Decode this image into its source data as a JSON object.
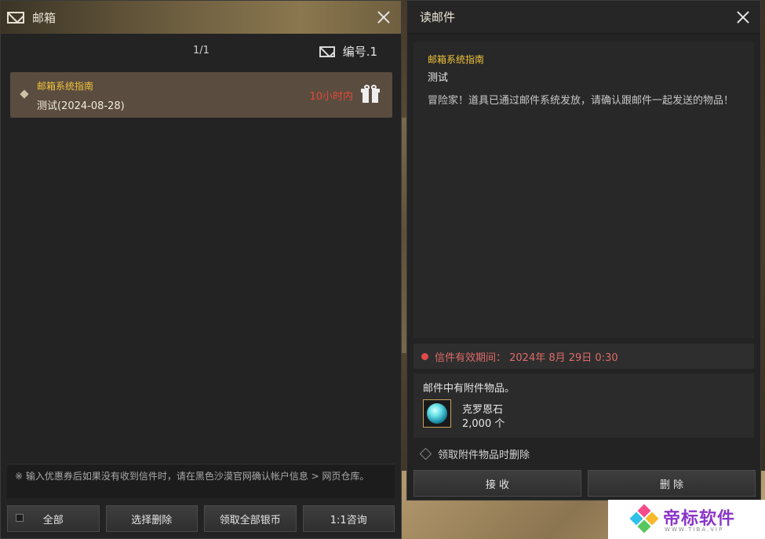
{
  "mailbox": {
    "title": "邮箱",
    "page_count": "1/1",
    "mail_number": "编号.1",
    "items": [
      {
        "title": "邮箱系统指南",
        "subtitle": "测试(2024-08-28)",
        "time": "10小时内"
      }
    ],
    "notice": "※ 输入优惠券后如果没有收到信件时，请在黑色沙漠官网确认帐户信息 > 网页仓库。",
    "buttons": {
      "all": "全部",
      "select_delete": "选择删除",
      "claim_all_silver": "领取全部银币",
      "consult": "1:1咨询"
    }
  },
  "read_mail": {
    "title": "读邮件",
    "mail_title": "邮箱系统指南",
    "mail_subtitle": "测试",
    "message": "冒险家！道具已通过邮件系统发放，请确认跟邮件一起发送的物品！",
    "expiry": "信件有效期间：  2024年 8月 29日 0:30",
    "attachment_label": "邮件中有附件物品。",
    "item_name": "克罗恩石",
    "item_qty": "2,000 个",
    "delete_on_claim": "领取附件物品时删除",
    "buttons": {
      "receive": "接 收",
      "delete": "删 除"
    }
  },
  "watermark": {
    "text": "帝标软件",
    "sub": "WWW.TIBA.VIP"
  },
  "colors": {
    "accent_gold": "#f0c23c",
    "alert_red": "#e04a3c",
    "item_border": "#c9a35a",
    "watermark": "#8b35c9"
  }
}
